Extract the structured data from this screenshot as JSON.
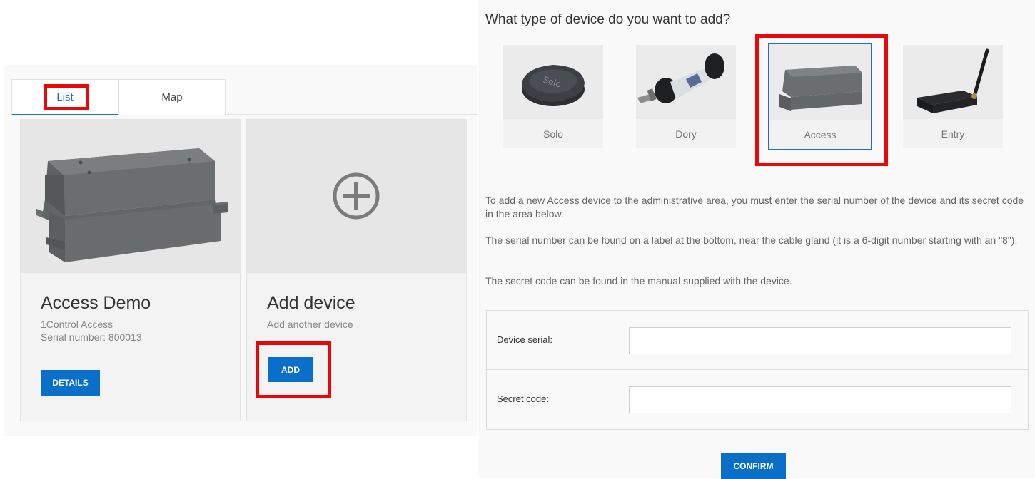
{
  "left": {
    "tabs": [
      {
        "label": "List",
        "active": true
      },
      {
        "label": "Map",
        "active": false
      }
    ],
    "cards": [
      {
        "title": "Access Demo",
        "subtitle": "1Control Access",
        "serial": "Serial number: 800013",
        "button": "DETAILS",
        "image": "grey-enclosure-box"
      },
      {
        "title": "Add device",
        "subtitle": "Add another device",
        "button": "ADD",
        "image": "plus-circle-icon"
      }
    ]
  },
  "right": {
    "question": "What type of device do you want to add?",
    "device_types": [
      {
        "label": "Solo",
        "image": "solo-remote"
      },
      {
        "label": "Dory",
        "image": "dory-cylinder"
      },
      {
        "label": "Access",
        "image": "access-box",
        "selected": true
      },
      {
        "label": "Entry",
        "image": "entry-antenna-box"
      }
    ],
    "info": [
      "To add a new Access device to the administrative area, you must enter the serial number of the device and its secret code in the area below.",
      "The serial number can be found on a label at the bottom, near the cable gland (it is a 6-digit number starting with an \"8\").",
      "The secret code can be found in the manual supplied with the device."
    ],
    "form": {
      "serial_label": "Device serial:",
      "serial_value": "",
      "code_label": "Secret code:",
      "code_value": ""
    },
    "confirm": "CONFIRM"
  },
  "colors": {
    "accent": "#0a6fc9",
    "highlight": "#e8070a",
    "selected_border": "#1e6fc7"
  }
}
